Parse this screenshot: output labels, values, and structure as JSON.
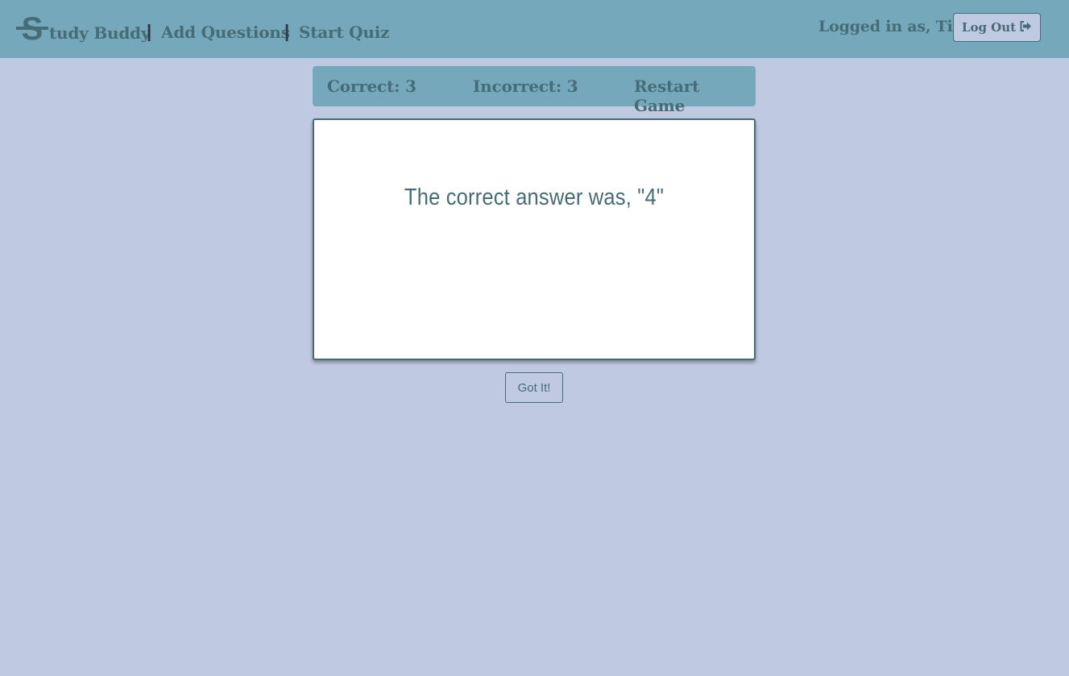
{
  "navbar": {
    "brand_initial": "S",
    "brand_rest": "tudy Buddy",
    "separator": "|",
    "links": [
      "Add Questions",
      "Start Quiz"
    ],
    "logged_in_text": "Logged in as, Tim",
    "logout_label": "Log Out",
    "logout_icon": "sign-out-icon"
  },
  "scoreboard": {
    "correct": "Correct: 3",
    "incorrect": "Incorrect: 3",
    "restart": "Restart Game"
  },
  "card": {
    "message": "The correct answer was, \"4\""
  },
  "actions": {
    "got_it": "Got It!"
  },
  "colors": {
    "background": "#c0c9e2",
    "navbar": "#75a8bb",
    "text": "#466d76",
    "card": "#ffffff"
  }
}
